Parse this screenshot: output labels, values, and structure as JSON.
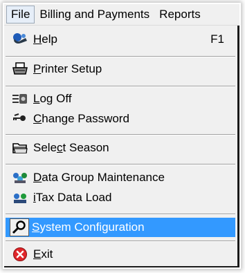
{
  "menubar": {
    "items": [
      {
        "label": "File"
      },
      {
        "label": "Billing and Payments"
      },
      {
        "label": "Reports"
      }
    ]
  },
  "menu": {
    "items": [
      {
        "pre": "",
        "accel": "H",
        "post": "elp",
        "shortcut": "F1",
        "icon": "help-icon"
      },
      {
        "pre": "",
        "accel": "P",
        "post": "rinter Setup",
        "icon": "printer-icon"
      },
      {
        "pre": "",
        "accel": "L",
        "post": "og Off",
        "icon": "log-off-icon"
      },
      {
        "pre": "",
        "accel": "C",
        "post": "hange Password",
        "icon": "keys-icon"
      },
      {
        "pre": "Sele",
        "accel": "c",
        "post": "t Season",
        "icon": "folder-icon"
      },
      {
        "pre": "",
        "accel": "D",
        "post": "ata Group Maintenance",
        "icon": "data-group-icon"
      },
      {
        "pre": "",
        "accel": "i",
        "post": "Tax Data Load",
        "icon": "data-load-icon"
      },
      {
        "pre": "",
        "accel": "S",
        "post": "ystem Configuration",
        "icon": "wrench-icon",
        "selected": true
      },
      {
        "pre": "",
        "accel": "E",
        "post": "xit",
        "icon": "exit-icon"
      }
    ]
  },
  "colors": {
    "selection": "#3399ff",
    "menu_bg": "#f0f0f0"
  }
}
